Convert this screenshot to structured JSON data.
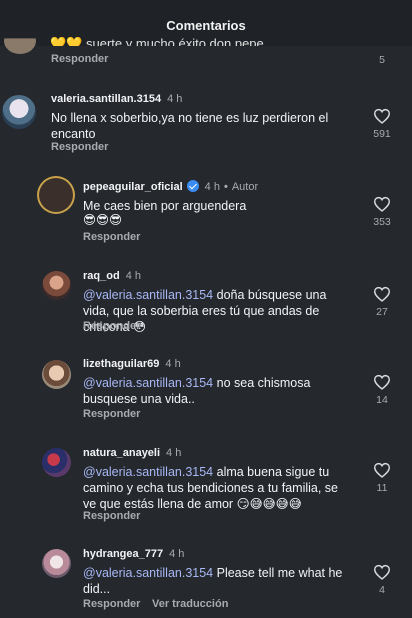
{
  "header": {
    "title": "Comentarios"
  },
  "partial_comment": {
    "text": "💛💛 suerte y mucho éxito don pepe",
    "reply_label": "Responder",
    "like_count": "5"
  },
  "comments": [
    {
      "username": "valeria.santillan.3154",
      "time": "4 h",
      "text": "No llena x soberbio,ya no  tiene es luz perdieron el encanto",
      "reply_label": "Responder",
      "like_count": "591"
    },
    {
      "username": "pepeaguilar_oficial",
      "time": "4 h",
      "author_label": "Autor",
      "text": "Me caes bien por arguendera",
      "emoji_line": "😎😎😎",
      "reply_label": "Responder",
      "like_count": "353"
    },
    {
      "username": "raq_od",
      "time": "4 h",
      "mention": "@valeria.santillan.3154",
      "text": " doña búsquese una vida, que la soberbia eres tú que andas de criticona 😳",
      "reply_label": "Responder",
      "like_count": "27"
    },
    {
      "username": "lizethaguilar69",
      "time": "4 h",
      "mention": "@valeria.santillan.3154",
      "text": " no sea chismosa busquese una vida..",
      "reply_label": "Responder",
      "like_count": "14"
    },
    {
      "username": "natura_anayeli",
      "time": "4 h",
      "mention": "@valeria.santillan.3154",
      "text": " alma buena sigue tu camino y echa tus bendiciones a tu familia, se ve que estás llena de amor 😏😅😅😅😅",
      "reply_label": "Responder",
      "like_count": "11"
    },
    {
      "username": "hydrangea_777",
      "time": "4 h",
      "mention": "@valeria.santillan.3154",
      "text": " Please tell me what he did...",
      "reply_label": "Responder",
      "translate_label": "Ver traducción",
      "like_count": "4"
    }
  ],
  "icons": {
    "like": "heart-outline-icon",
    "verified": "verified-badge-icon"
  },
  "colors": {
    "background": "#25282d",
    "mention": "#a7b8f4",
    "verified": "#3b8cf2"
  }
}
